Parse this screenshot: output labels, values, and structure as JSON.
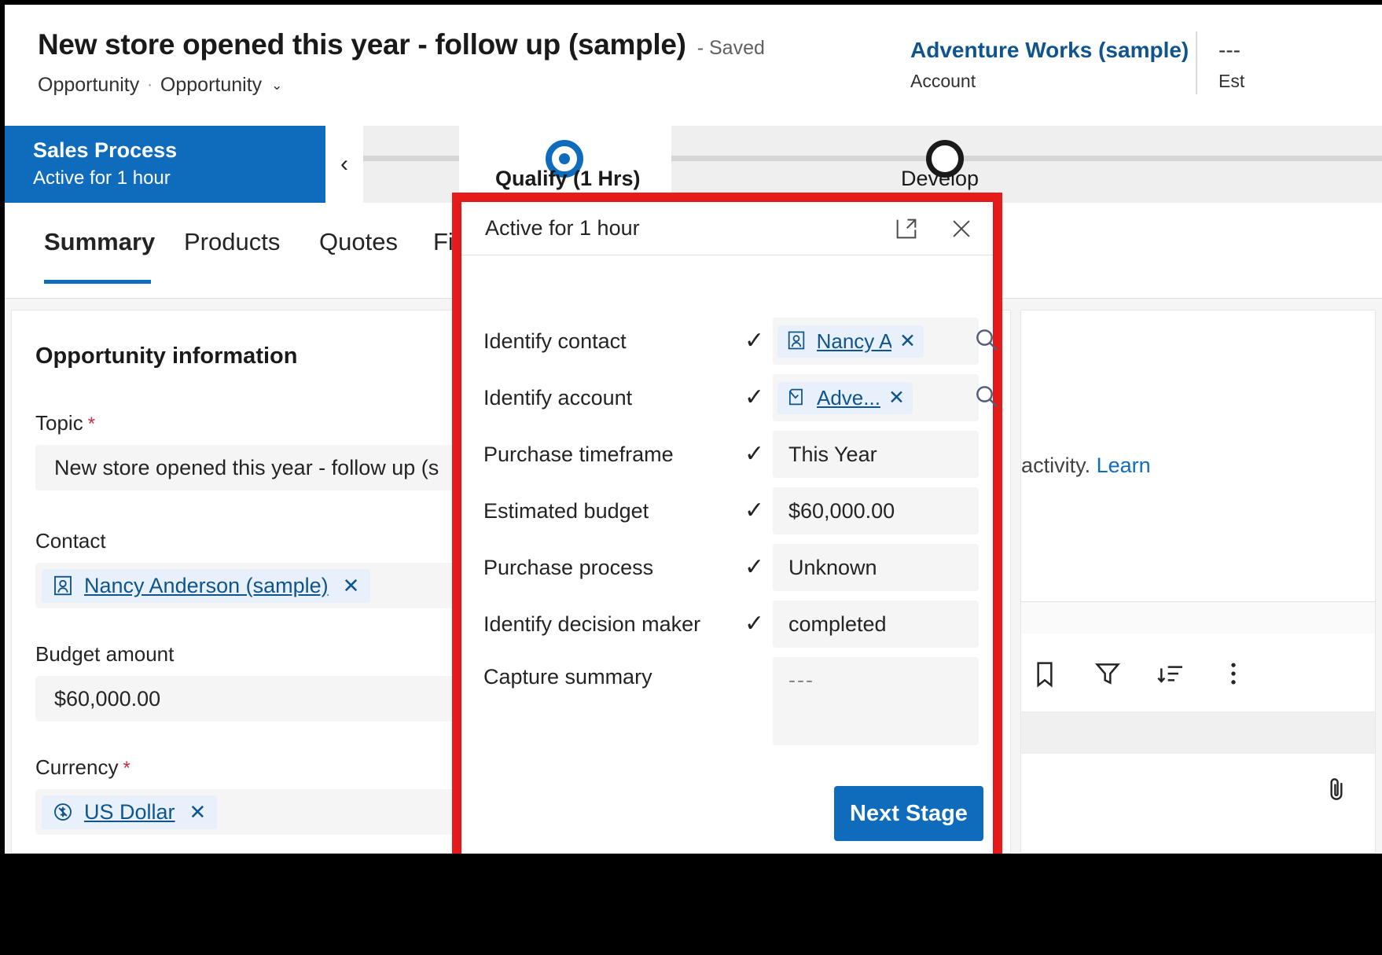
{
  "header": {
    "record_title": "New store opened this year - follow up (sample)",
    "saved_status": "- Saved",
    "entity_name": "Opportunity",
    "separator": "·",
    "form_name": "Opportunity",
    "form_caret": "⌄",
    "related_account": "Adventure Works (sample)",
    "related_account_label": "Account",
    "est_value": "---",
    "est_value_label": "Est"
  },
  "process_bar": {
    "name": "Sales Process",
    "status": "Active for 1 hour",
    "collapse_icon": "‹",
    "stages": [
      {
        "label": "Qualify  (1 Hrs)",
        "state": "active"
      },
      {
        "label": "Develop",
        "state": "upcoming"
      }
    ]
  },
  "tabs": [
    {
      "label": "Summary",
      "active": true
    },
    {
      "label": "Products",
      "active": false
    },
    {
      "label": "Quotes",
      "active": false
    },
    {
      "label": "Fil",
      "active": false
    }
  ],
  "form": {
    "section_title": "Opportunity information",
    "refresh_icon": "refresh-icon",
    "fields": [
      {
        "label": "Topic",
        "required": true,
        "type": "text",
        "value": "New store opened this year - follow up (s"
      },
      {
        "label": "Contact",
        "required": false,
        "type": "lookup",
        "value": "Nancy Anderson (sample)",
        "icon": "contact-icon",
        "clear": "✕"
      },
      {
        "label": "Budget amount",
        "required": false,
        "type": "text",
        "value": "$60,000.00"
      },
      {
        "label": "Currency",
        "required": true,
        "type": "lookup",
        "value": "US Dollar",
        "icon": "currency-icon",
        "clear": "✕"
      }
    ]
  },
  "timeline": {
    "message_text": "g an activity. ",
    "message_link": "Learn",
    "toolbar_icons": [
      "bookmark-icon",
      "filter-icon",
      "sort-icon",
      "more-options-icon"
    ],
    "attachment_icon": "paperclip-icon"
  },
  "dialog": {
    "title": "Active for 1 hour",
    "expand_icon": "open-in-new-window-icon",
    "close_icon": "✕",
    "next_stage_label": "Next Stage",
    "rows": [
      {
        "label": "Identify contact",
        "checked": true,
        "type": "lookup",
        "value": "Nancy A",
        "icon": "contact-icon",
        "clear": "✕",
        "search": "search-icon"
      },
      {
        "label": "Identify account",
        "checked": true,
        "type": "lookup",
        "value": "Adve...",
        "icon": "account-icon",
        "clear": "✕",
        "search": "search-icon"
      },
      {
        "label": "Purchase timeframe",
        "checked": true,
        "type": "text",
        "value": "This Year"
      },
      {
        "label": "Estimated budget",
        "checked": true,
        "type": "text",
        "value": "$60,000.00"
      },
      {
        "label": "Purchase process",
        "checked": true,
        "type": "text",
        "value": "Unknown"
      },
      {
        "label": "Identify decision maker",
        "checked": true,
        "type": "text",
        "value": "completed"
      },
      {
        "label": "Capture summary",
        "checked": false,
        "type": "textarea",
        "value": "---"
      }
    ],
    "check_glyph": "✓"
  },
  "colors": {
    "accent_blue": "#0f6cbd",
    "link_blue": "#0f548c",
    "highlight_red": "#e81b1b",
    "required_red": "#c4314b"
  }
}
